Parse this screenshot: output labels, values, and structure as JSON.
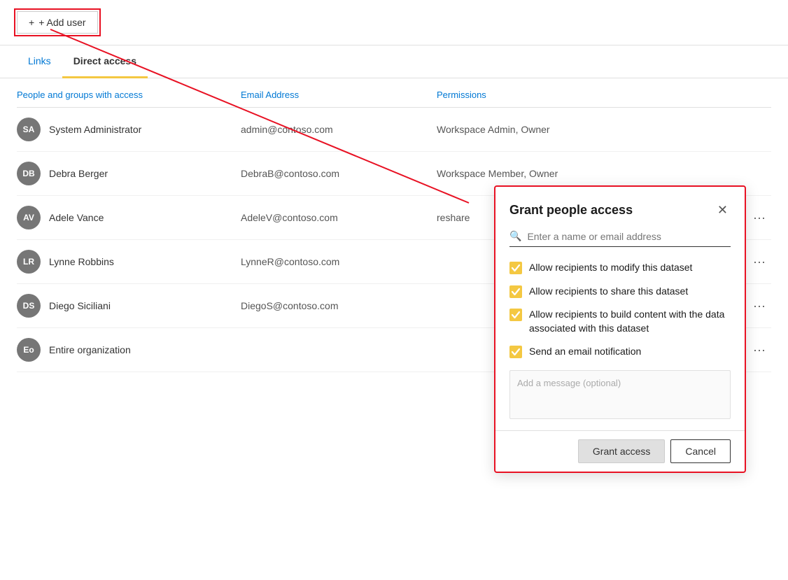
{
  "topBar": {
    "addUserLabel": "+ Add user"
  },
  "tabs": [
    {
      "id": "links",
      "label": "Links",
      "active": false
    },
    {
      "id": "direct-access",
      "label": "Direct access",
      "active": true
    }
  ],
  "tableHeaders": {
    "col1": "People and groups with access",
    "col2": "Email Address",
    "col3": "Permissions"
  },
  "tableRows": [
    {
      "initials": "SA",
      "name": "System Administrator",
      "email": "admin@contoso.com",
      "permissions": "Workspace Admin, Owner",
      "showMore": false
    },
    {
      "initials": "DB",
      "name": "Debra Berger",
      "email": "DebraB@contoso.com",
      "permissions": "Workspace Member, Owner",
      "showMore": false
    },
    {
      "initials": "AV",
      "name": "Adele Vance",
      "email": "AdeleV@contoso.com",
      "permissions": "",
      "reshare": "reshare",
      "showMore": true
    },
    {
      "initials": "LR",
      "name": "Lynne Robbins",
      "email": "LynneR@contoso.com",
      "permissions": "",
      "showMore": true
    },
    {
      "initials": "DS",
      "name": "Diego Siciliani",
      "email": "DiegoS@contoso.com",
      "permissions": "",
      "showMore": true
    },
    {
      "initials": "Eo",
      "name": "Entire organization",
      "email": "",
      "permissions": "",
      "showMore": true
    }
  ],
  "modal": {
    "title": "Grant people access",
    "searchPlaceholder": "Enter a name or email address",
    "checkboxes": [
      {
        "id": "modify",
        "label": "Allow recipients to modify this dataset",
        "checked": true
      },
      {
        "id": "share",
        "label": "Allow recipients to share this dataset",
        "checked": true
      },
      {
        "id": "build",
        "label": "Allow recipients to build content with the data associated with this dataset",
        "checked": true
      },
      {
        "id": "email",
        "label": "Send an email notification",
        "checked": true
      }
    ],
    "messagePlaceholder": "Add a message (optional)",
    "grantButton": "Grant access",
    "cancelButton": "Cancel"
  },
  "colors": {
    "accent": "#f4c842",
    "link": "#0078d4",
    "checked": "#f4c842",
    "red": "#e81123"
  }
}
